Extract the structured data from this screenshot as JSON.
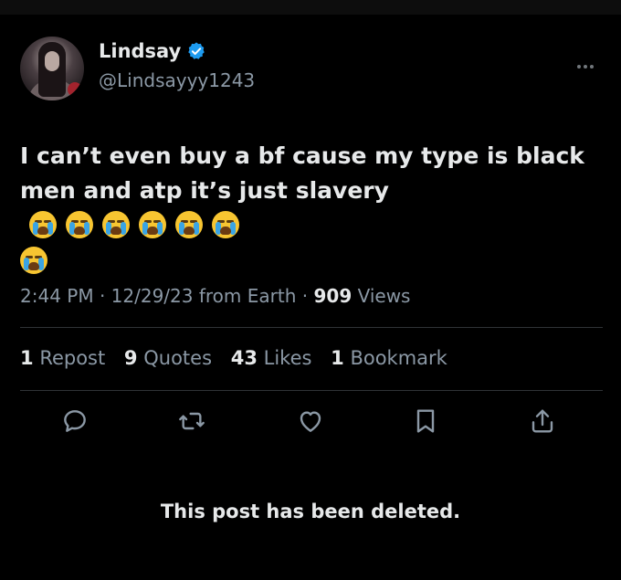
{
  "author": {
    "name": "Lindsay",
    "handle": "@Lindsayyy1243",
    "verified": true,
    "avatar_icon": "profile-photo",
    "badge_color": "#1d9bf0"
  },
  "tweet": {
    "text": "I can’t even buy a bf cause my type is black men and atp it’s just slavery",
    "emoji_count": 7,
    "emoji_icon": "loudly-crying-face"
  },
  "meta": {
    "time": "2:44 PM",
    "date": "12/29/23",
    "source": "from Earth",
    "views_count": "909",
    "views_label": "Views",
    "sep": "·"
  },
  "stats": {
    "reposts_count": "1",
    "reposts_label": "Repost",
    "quotes_count": "9",
    "quotes_label": "Quotes",
    "likes_count": "43",
    "likes_label": "Likes",
    "bookmarks_count": "1",
    "bookmarks_label": "Bookmark"
  },
  "actions": [
    "reply-icon",
    "repost-icon",
    "like-icon",
    "bookmark-icon",
    "share-icon"
  ],
  "footer": {
    "deleted_notice": "This post has been deleted."
  },
  "colors": {
    "background": "#000000",
    "text_primary": "#e7e9ea",
    "text_secondary": "#8b98a5",
    "divider": "#2f3336"
  }
}
